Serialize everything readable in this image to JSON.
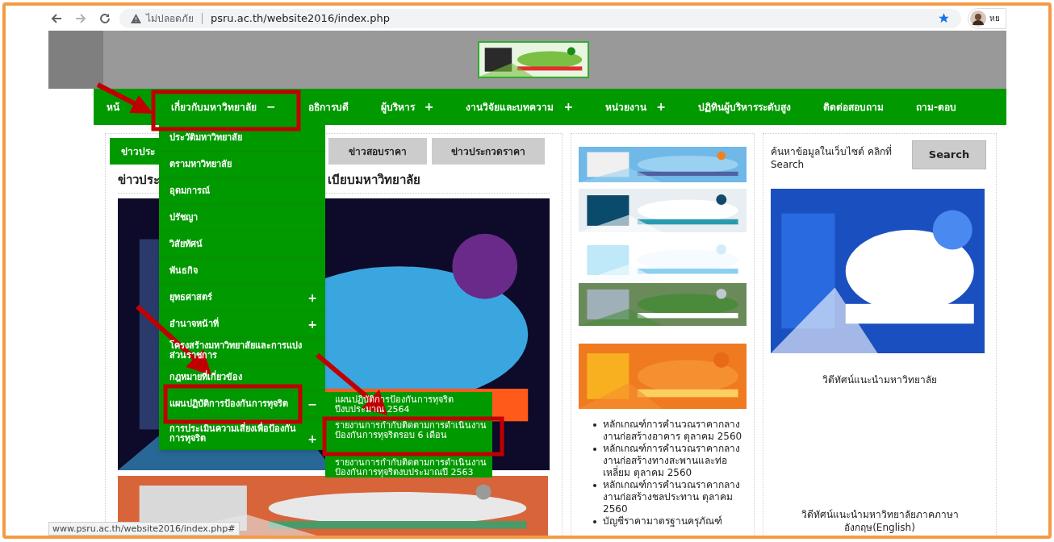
{
  "browser": {
    "security": "ไม่ปลอดภัย",
    "url": "psru.ac.th/website2016/index.php",
    "profile_label": "หย",
    "status_url": "www.psru.ac.th/website2016/index.php#"
  },
  "nav": [
    {
      "label": "หน้"
    },
    {
      "label": "เกี่ยวกับมหาวิทยาลัย",
      "toggle": "−"
    },
    {
      "label": "อธิการบดี"
    },
    {
      "label": "ผู้บริหาร",
      "toggle": "+"
    },
    {
      "label": "งานวิจัยและบทความ",
      "toggle": "+"
    },
    {
      "label": "หน่วยงาน",
      "toggle": "+"
    },
    {
      "label": "ปฏิทินผู้บริหารระดับสูง"
    },
    {
      "label": "ติดต่อสอบถาม"
    },
    {
      "label": "ถาม-ตอบ"
    }
  ],
  "dropdown": [
    {
      "label": "ประวัติมหาวิทยาลัย"
    },
    {
      "label": "ตรามหาวิทยาลัย"
    },
    {
      "label": "อุดมการณ์"
    },
    {
      "label": "ปรัชญา"
    },
    {
      "label": "วิสัยทัศน์"
    },
    {
      "label": "พันธกิจ"
    },
    {
      "label": "ยุทธศาสตร์",
      "toggle": "+"
    },
    {
      "label": "อำนาจหน้าที่",
      "toggle": "+"
    },
    {
      "label": "โครงสร้างมหาวิทยาลัยและการแบ่งส่วนราชการ"
    },
    {
      "label": "กฎหมายที่เกี่ยวข้อง"
    },
    {
      "label": "แผนปฏิบัติการป้องกันการทุจริต",
      "toggle": "−"
    },
    {
      "label": "การประเมินความเสี่ยงเพื่อป้องกันการทุจริต",
      "toggle": "+"
    }
  ],
  "submenu": [
    "แผนปฏิบัติการป้องกันการทุจริต ปีงบประมาณ 2564",
    "รายงานการกำกับติดตามการดำเนินงานป้องกันการทุจริตรอบ 6 เดือน",
    "รายงานการกำกับติดตามการดำเนินงานป้องกันการทุจริตงบประมาณปี 2563"
  ],
  "news": {
    "tabs": [
      {
        "label": "ข่าวประ",
        "selected": true
      },
      {
        "label": "ข่าวสอบราคา",
        "selected": false
      },
      {
        "label": "ข่าวประกวดราคา",
        "selected": false
      }
    ],
    "heading_parts": [
      "ข่าวประ",
      "เบียบมหาวิทยาลัย"
    ]
  },
  "price_list": [
    "หลักเกณฑ์การคำนวณราคากลางงานก่อสร้างอาคาร ตุลาคม 2560",
    "หลักเกณฑ์การคำนวณราคากลางงานก่อสร้างทางสะพานและท่อเหลี่ยม ตุลาคม 2560",
    "หลักเกณฑ์การคำนวณราคากลางงานก่อสร้างชลประทาน ตุลาคม 2560",
    "บัญชีราคามาตรฐานครุภัณฑ์"
  ],
  "search": {
    "prompt": "ค้นหาข้อมูลในเว็บไซต์ คลิกที่ Search",
    "button": "Search"
  },
  "videos": [
    "วิดีทัศน์แนะนำมหาวิทยาลัย",
    "วิดีทัศน์แนะนำมหาวิทยาลัยภาคภาษาอังกฤษ(English)"
  ]
}
